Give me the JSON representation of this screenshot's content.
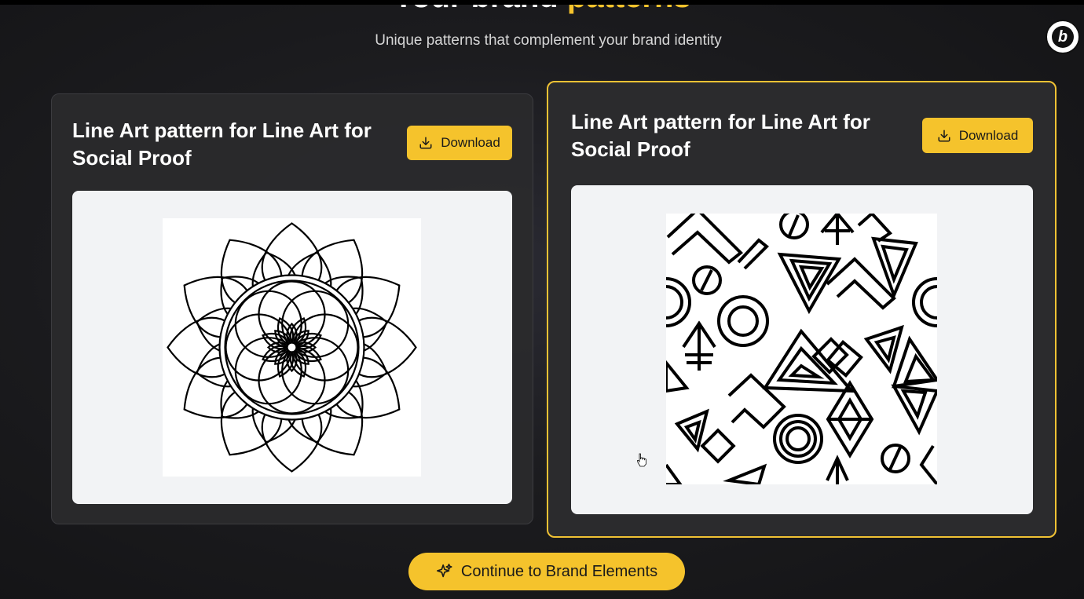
{
  "header": {
    "title_part1": "Your brand",
    "title_accent": "patterns",
    "subtitle": "Unique patterns that complement your brand identity"
  },
  "badge": {
    "icon": "brand-b-logo-icon",
    "letter": "b"
  },
  "cards": [
    {
      "title": "Line Art pattern for Line Art for Social Proof",
      "download_label": "Download",
      "preview_icon": "mandala-line-art-pattern",
      "selected": false
    },
    {
      "title": "Line Art pattern for Line Art for Social Proof",
      "download_label": "Download",
      "preview_icon": "geometric-line-art-pattern",
      "selected": true
    }
  ],
  "continue_button": {
    "label": "Continue to Brand Elements",
    "icon": "sparkles-icon"
  },
  "colors": {
    "accent": "#f5c32c",
    "background": "#1c1c1f",
    "card": "#2b2b2d",
    "preview_bg": "#f2f3f5"
  }
}
